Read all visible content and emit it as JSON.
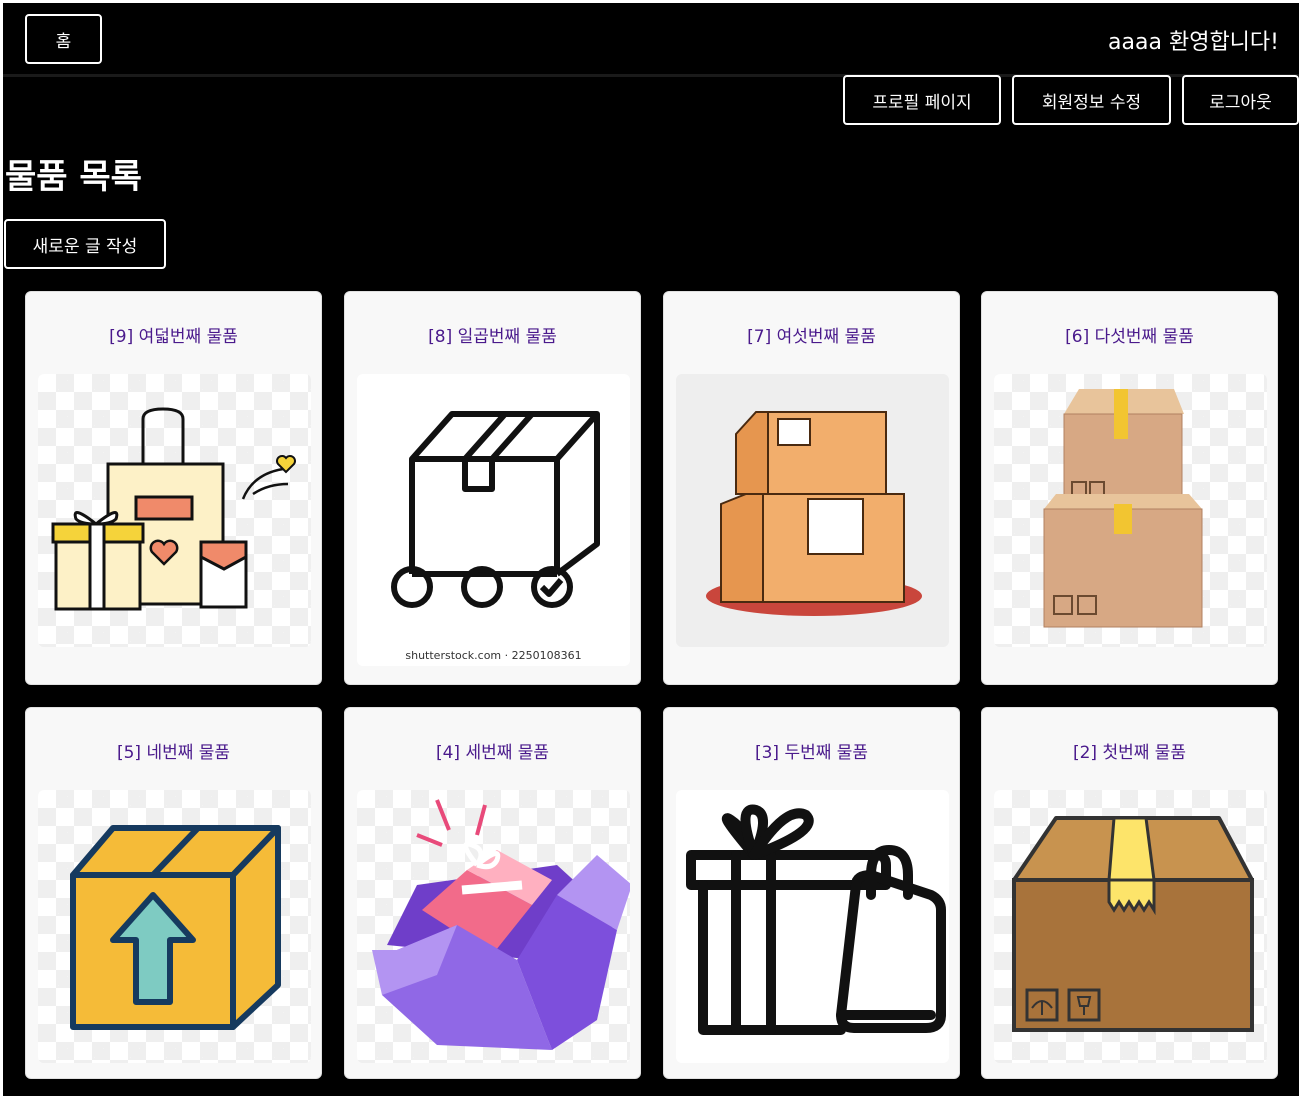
{
  "header": {
    "home_label": "홈",
    "welcome_text": "aaaa 환영합니다!",
    "profile_label": "프로필 페이지",
    "edit_info_label": "회원정보 수정",
    "logout_label": "로그아웃"
  },
  "main": {
    "title": "물품 목록",
    "new_post_label": "새로운 글 작성"
  },
  "items": [
    {
      "title": "[9] 여덟번째 물품",
      "icon": "shopping-gifts-icon"
    },
    {
      "title": "[8] 일곱번째 물품",
      "icon": "box-cart-icon",
      "credit": "shutterstock.com · 2250108361"
    },
    {
      "title": "[7] 여섯번째 물품",
      "icon": "stacked-boxes-icon"
    },
    {
      "title": "[6] 다섯번째 물품",
      "icon": "cardboard-boxes-icon"
    },
    {
      "title": "[5] 네번째 물품",
      "icon": "box-upload-icon"
    },
    {
      "title": "[4] 세번째 물품",
      "icon": "open-gift-box-icon"
    },
    {
      "title": "[3] 두번째 물품",
      "icon": "gift-bag-icon"
    },
    {
      "title": "[2] 첫번째 물품",
      "icon": "package-box-icon"
    }
  ]
}
